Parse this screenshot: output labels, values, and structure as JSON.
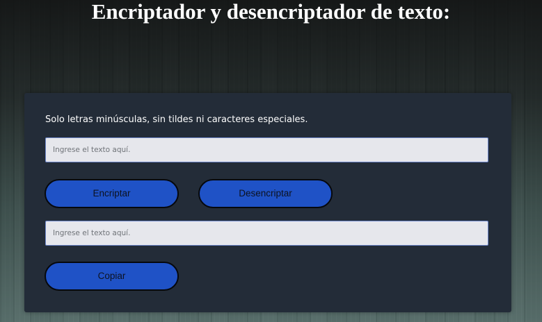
{
  "header": {
    "title": "Encriptador y desencriptador de texto:"
  },
  "form": {
    "hint": "Solo letras minúsculas, sin tildes ni caracteres especiales.",
    "input_placeholder": "Ingrese el texto aquí.",
    "input_value": "",
    "output_placeholder": "Ingrese el texto aquí.",
    "output_value": "",
    "encrypt_label": "Encriptar",
    "decrypt_label": "Desencriptar",
    "copy_label": "Copiar"
  },
  "colors": {
    "panel_background": "#232c38",
    "button_fill": "#1f52c6",
    "input_background": "#e6e7ec"
  }
}
